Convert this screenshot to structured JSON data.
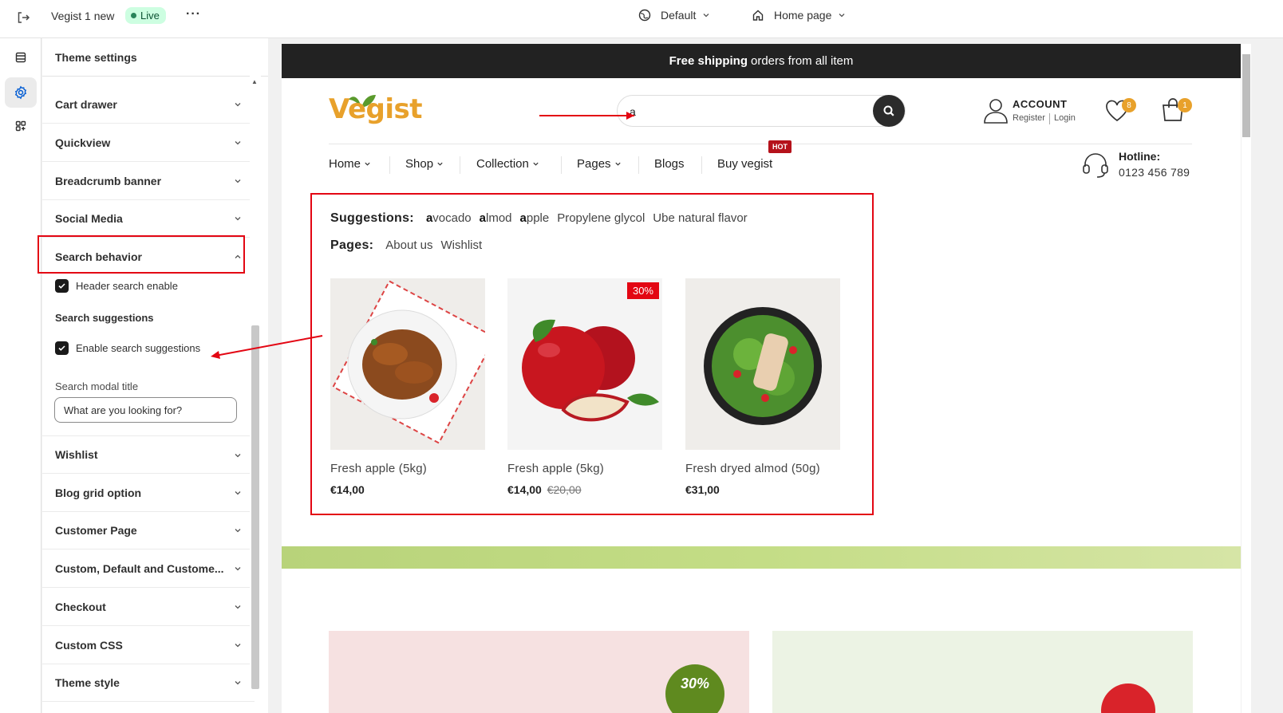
{
  "topbar": {
    "store_title": "Vegist 1 new",
    "status_badge": "Live",
    "more_icon": "more-horizontal-icon",
    "theme_selector": "Default",
    "page_selector": "Home page"
  },
  "rail": {
    "items": [
      "sections-icon",
      "settings-icon",
      "apps-icon"
    ],
    "active": "settings-icon"
  },
  "panel": {
    "title": "Theme settings",
    "sections_before": [
      "Cart drawer",
      "Quickview",
      "Breadcrumb banner",
      "Social Media"
    ],
    "expanded_section": "Search behavior",
    "header_search_enable": "Header search enable",
    "header_search_checked": true,
    "search_suggestions_heading": "Search suggestions",
    "enable_search_suggestions": "Enable search suggestions",
    "enable_search_suggestions_checked": true,
    "search_modal_title_label": "Search modal title",
    "search_modal_title_value": "What are you looking for?",
    "sections_after": [
      "Wishlist",
      "Blog grid option",
      "Customer Page",
      "Custom, Default and Custome...",
      "Checkout",
      "Custom CSS",
      "Theme style"
    ]
  },
  "preview": {
    "announcement_bold": "Free shipping",
    "announcement_rest": "orders from all item",
    "logo": "Vegist",
    "search_query": "a",
    "account_title": "ACCOUNT",
    "account_register": "Register",
    "account_login": "Login",
    "wishlist_count": "8",
    "cart_count": "1",
    "nav": [
      "Home",
      "Shop",
      "Collection",
      "Pages",
      "Blogs",
      "Buy vegist"
    ],
    "hot_badge": "HOT",
    "hotline_label": "Hotline:",
    "hotline_number": "0123 456 789",
    "suggestions_label": "Suggestions:",
    "suggestions": [
      {
        "bold": "a",
        "rest": "vocado"
      },
      {
        "bold": "a",
        "rest": "lmod"
      },
      {
        "bold": "a",
        "rest": "pple"
      },
      {
        "bold": "",
        "rest": "Propylene glycol"
      },
      {
        "bold": "",
        "rest": "Ube natural flavor"
      }
    ],
    "pages_label": "Pages:",
    "pages": [
      "About us",
      "Wishlist"
    ],
    "products": [
      {
        "name": "Fresh apple (5kg)",
        "price": "€14,00",
        "old_price": "",
        "sale": ""
      },
      {
        "name": "Fresh apple (5kg)",
        "price": "€14,00",
        "old_price": "€20,00",
        "sale": "30%"
      },
      {
        "name": "Fresh dryed almod (50g)",
        "price": "€31,00",
        "old_price": "",
        "sale": ""
      }
    ],
    "promo_badge": "30%"
  },
  "colors": {
    "accent_red": "#e30613",
    "brand_orange": "#e8a12b",
    "brand_green": "#5a9a2c",
    "live_green": "#cdfee1"
  }
}
